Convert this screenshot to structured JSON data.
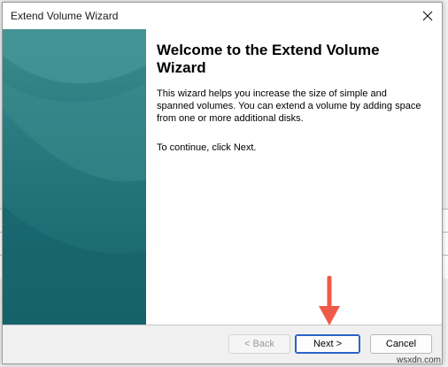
{
  "window": {
    "title": "Extend Volume Wizard"
  },
  "icons": {
    "close": "close-icon",
    "annotation": "red-arrow-icon"
  },
  "colors": {
    "side_panel": "#1f6f76",
    "default_button_border": "#2a63c5",
    "annotation_arrow": "#ef5a48"
  },
  "content": {
    "heading": "Welcome to the Extend Volume Wizard",
    "paragraph": "This wizard helps you increase the size of simple and spanned volumes. You can extend a volume  by adding space from one or more additional disks.",
    "continue_text": "To continue, click Next."
  },
  "buttons": {
    "back_label": "< Back",
    "next_label": "Next >",
    "cancel_label": "Cancel"
  },
  "watermark": "wsxdn.com"
}
